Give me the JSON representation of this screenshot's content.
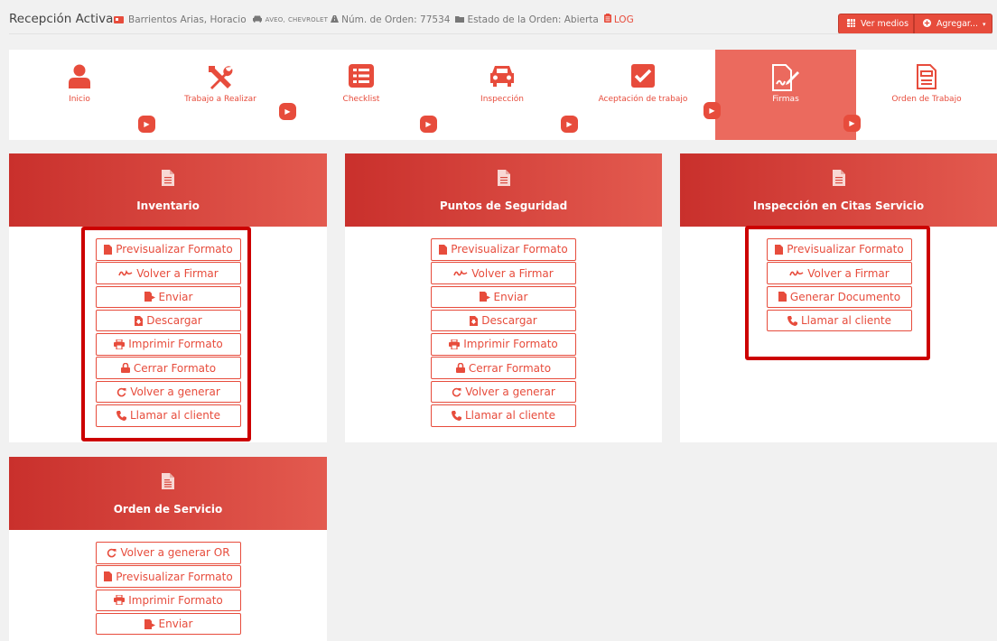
{
  "header": {
    "title": "Recepción Activa",
    "client": "Barrientos Arias, Horacio",
    "vehicle_model": "AVEO,",
    "vehicle_brand": "CHEVROLET",
    "order_label": "Núm. de Orden: 77534",
    "status_label": "Estado de la Orden: Abierta",
    "log_label": "LOG",
    "ver_medios": "Ver medios",
    "agregar": "Agregar..."
  },
  "steps": [
    {
      "label": "Inicio",
      "icon": "user-icon",
      "active": false
    },
    {
      "label": "Trabajo a Realizar",
      "icon": "tools-icon",
      "active": false
    },
    {
      "label": "Checklist",
      "icon": "list-icon",
      "active": false
    },
    {
      "label": "Inspección",
      "icon": "car-icon",
      "active": false
    },
    {
      "label": "Aceptación de trabajo",
      "icon": "check-square-icon",
      "active": false
    },
    {
      "label": "Firmas",
      "icon": "signature-icon",
      "active": true
    },
    {
      "label": "Orden de Trabajo",
      "icon": "document-icon",
      "active": false
    }
  ],
  "cards": [
    {
      "title": "Inventario",
      "buttons": [
        {
          "label": "Previsualizar Formato",
          "icon": "file-icon"
        },
        {
          "label": "Volver a Firmar",
          "icon": "signature-icon"
        },
        {
          "label": "Enviar",
          "icon": "send-file-icon"
        },
        {
          "label": "Descargar",
          "icon": "download-file-icon"
        },
        {
          "label": "Imprimir Formato",
          "icon": "print-icon"
        },
        {
          "label": "Cerrar Formato",
          "icon": "lock-icon"
        },
        {
          "label": "Volver a generar",
          "icon": "refresh-icon"
        },
        {
          "label": "Llamar al cliente",
          "icon": "phone-icon"
        }
      ]
    },
    {
      "title": "Puntos de Seguridad",
      "buttons": [
        {
          "label": "Previsualizar Formato",
          "icon": "file-icon"
        },
        {
          "label": "Volver a Firmar",
          "icon": "signature-icon"
        },
        {
          "label": "Enviar",
          "icon": "send-file-icon"
        },
        {
          "label": "Descargar",
          "icon": "download-file-icon"
        },
        {
          "label": "Imprimir Formato",
          "icon": "print-icon"
        },
        {
          "label": "Cerrar Formato",
          "icon": "lock-icon"
        },
        {
          "label": "Volver a generar",
          "icon": "refresh-icon"
        },
        {
          "label": "Llamar al cliente",
          "icon": "phone-icon"
        }
      ]
    },
    {
      "title": "Inspección en Citas Servicio",
      "buttons": [
        {
          "label": "Previsualizar Formato",
          "icon": "file-icon"
        },
        {
          "label": "Volver a Firmar",
          "icon": "signature-icon"
        },
        {
          "label": "Generar Documento",
          "icon": "file-icon"
        },
        {
          "label": "Llamar al cliente",
          "icon": "phone-icon"
        }
      ]
    },
    {
      "title": "Orden de Servicio",
      "buttons": [
        {
          "label": "Volver a generar OR",
          "icon": "refresh-icon"
        },
        {
          "label": "Previsualizar Formato",
          "icon": "file-icon"
        },
        {
          "label": "Imprimir Formato",
          "icon": "print-icon"
        },
        {
          "label": "Enviar",
          "icon": "send-file-icon"
        }
      ]
    }
  ],
  "colors": {
    "accent": "#e74c3c",
    "highlight": "#cc0000",
    "active_step": "#eb6a5e"
  }
}
